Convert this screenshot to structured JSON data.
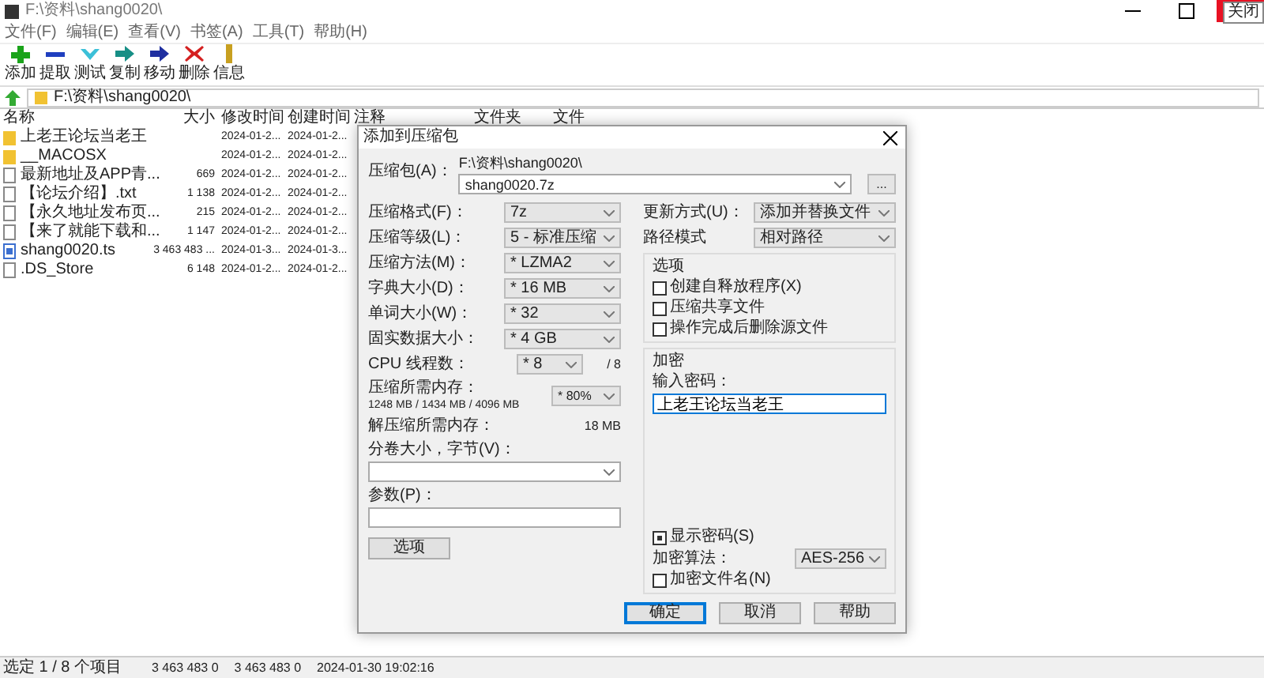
{
  "window": {
    "title": "F:\\资料\\shang0020\\",
    "close_tooltip": "关闭"
  },
  "menu": [
    "文件(F)",
    "编辑(E)",
    "查看(V)",
    "书签(A)",
    "工具(T)",
    "帮助(H)"
  ],
  "toolbar": [
    {
      "kind": "add",
      "label": "添加"
    },
    {
      "kind": "extract",
      "label": "提取"
    },
    {
      "kind": "test",
      "label": "测试"
    },
    {
      "kind": "copy",
      "label": "复制"
    },
    {
      "kind": "move",
      "label": "移动"
    },
    {
      "kind": "delete",
      "label": "删除"
    },
    {
      "kind": "info",
      "label": "信息"
    }
  ],
  "address": "F:\\资料\\shang0020\\",
  "columns": [
    "名称",
    "大小",
    "修改时间",
    "创建时间",
    "注释",
    "文件夹",
    "文件"
  ],
  "rows": [
    {
      "kind": "folder",
      "name": "上老王论坛当老王",
      "modified": "2024-01-2...",
      "created": "2024-01-2..."
    },
    {
      "kind": "folder",
      "name": "__MACOSX",
      "modified": "2024-01-2...",
      "created": "2024-01-2..."
    },
    {
      "kind": "file",
      "name": "最新地址及APP青...",
      "size": "669",
      "modified": "2024-01-2...",
      "created": "2024-01-2..."
    },
    {
      "kind": "file",
      "name": "【论坛介绍】.txt",
      "size": "1 138",
      "modified": "2024-01-2...",
      "created": "2024-01-2..."
    },
    {
      "kind": "file",
      "name": "【永久地址发布页...",
      "size": "215",
      "modified": "2024-01-2...",
      "created": "2024-01-2..."
    },
    {
      "kind": "file",
      "name": "【来了就能下载和...",
      "size": "1 147",
      "modified": "2024-01-2...",
      "created": "2024-01-2..."
    },
    {
      "kind": "video",
      "name": "shang0020.ts",
      "size": "3 463 483 ...",
      "modified": "2024-01-3...",
      "created": "2024-01-3..."
    },
    {
      "kind": "file",
      "name": ".DS_Store",
      "size": "6 148",
      "modified": "2024-01-2...",
      "created": "2024-01-2..."
    }
  ],
  "dialog": {
    "title": "添加到压缩包",
    "archive_label": "压缩包(A)：",
    "archive_path": "F:\\资料\\shang0020\\",
    "archive_name": "shang0020.7z",
    "browse": "...",
    "left": [
      {
        "kind": "select",
        "label": "压缩格式(F)：",
        "value": "7z"
      },
      {
        "kind": "select",
        "label": "压缩等级(L)：",
        "value": "5 - 标准压缩"
      },
      {
        "kind": "select",
        "label": "压缩方法(M)：",
        "value": "* LZMA2"
      },
      {
        "kind": "select",
        "label": "字典大小(D)：",
        "value": "* 16 MB"
      },
      {
        "kind": "select",
        "label": "单词大小(W)：",
        "value": "* 32"
      },
      {
        "kind": "select",
        "label": "固实数据大小：",
        "value": "* 4 GB"
      },
      {
        "kind": "threads",
        "label": "CPU 线程数：",
        "value": "* 8",
        "note": "/ 8"
      },
      {
        "kind": "memory",
        "label": "压缩所需内存：",
        "note": "1248 MB / 1434 MB / 4096 MB",
        "value": "* 80%"
      },
      {
        "kind": "text",
        "label": "解压缩所需内存：",
        "value": "18 MB"
      },
      {
        "kind": "combo",
        "label": "分卷大小，字节(V)："
      },
      {
        "kind": "input",
        "label": "参数(P)："
      }
    ],
    "options_button": "选项",
    "update_label": "更新方式(U)：",
    "update_value": "添加并替换文件",
    "path_label": "路径模式",
    "path_value": "相对路径",
    "options_group": "选项",
    "options": [
      {
        "label": "创建自释放程序(X)",
        "checked": false
      },
      {
        "label": "压缩共享文件",
        "checked": false
      },
      {
        "label": "操作完成后删除源文件",
        "checked": false
      }
    ],
    "encryption_group": "加密",
    "password_label": "输入密码：",
    "password": "上老王论坛当老王",
    "show_password": {
      "label": "显示密码(S)",
      "checked": true
    },
    "method_label": "加密算法：",
    "method_value": "AES-256",
    "encrypt_names": {
      "label": "加密文件名(N)",
      "checked": false
    },
    "buttons": [
      {
        "label": "确定",
        "selected": true
      },
      {
        "label": "取消",
        "selected": false
      },
      {
        "label": "帮助",
        "selected": false
      }
    ]
  },
  "status": [
    "选定 1 / 8 个项目",
    "3 463 483 0",
    "3 463 483 0",
    "2024-01-30 19:02:16"
  ]
}
